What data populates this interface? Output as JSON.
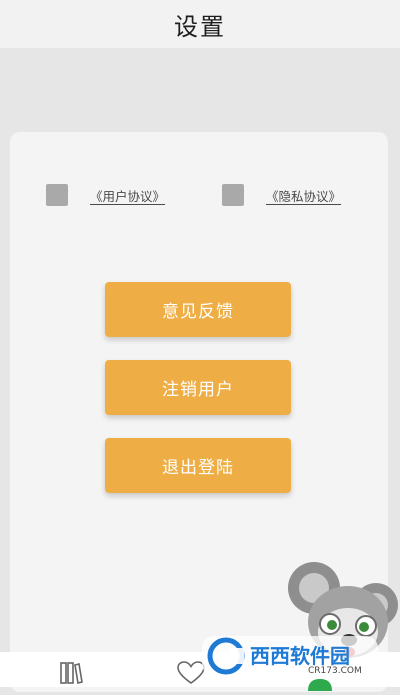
{
  "header": {
    "title": "设置"
  },
  "agreements": {
    "user_agreement": "《用户协议》",
    "privacy_agreement": "《隐私协议》"
  },
  "buttons": {
    "feedback": "意见反馈",
    "deregister": "注销用户",
    "logout": "退出登陆"
  },
  "icons": {
    "tab_1": "books-icon",
    "tab_2": "heart-icon",
    "tab_3": "mine-icon"
  },
  "watermark": {
    "brand": "西西软件园",
    "site": "CR173.COM",
    "mascot": "koala-mascot"
  },
  "colors": {
    "accent": "#eeae45",
    "checkbox": "#a9a9a9",
    "active_tab": "#2eaa4d"
  }
}
